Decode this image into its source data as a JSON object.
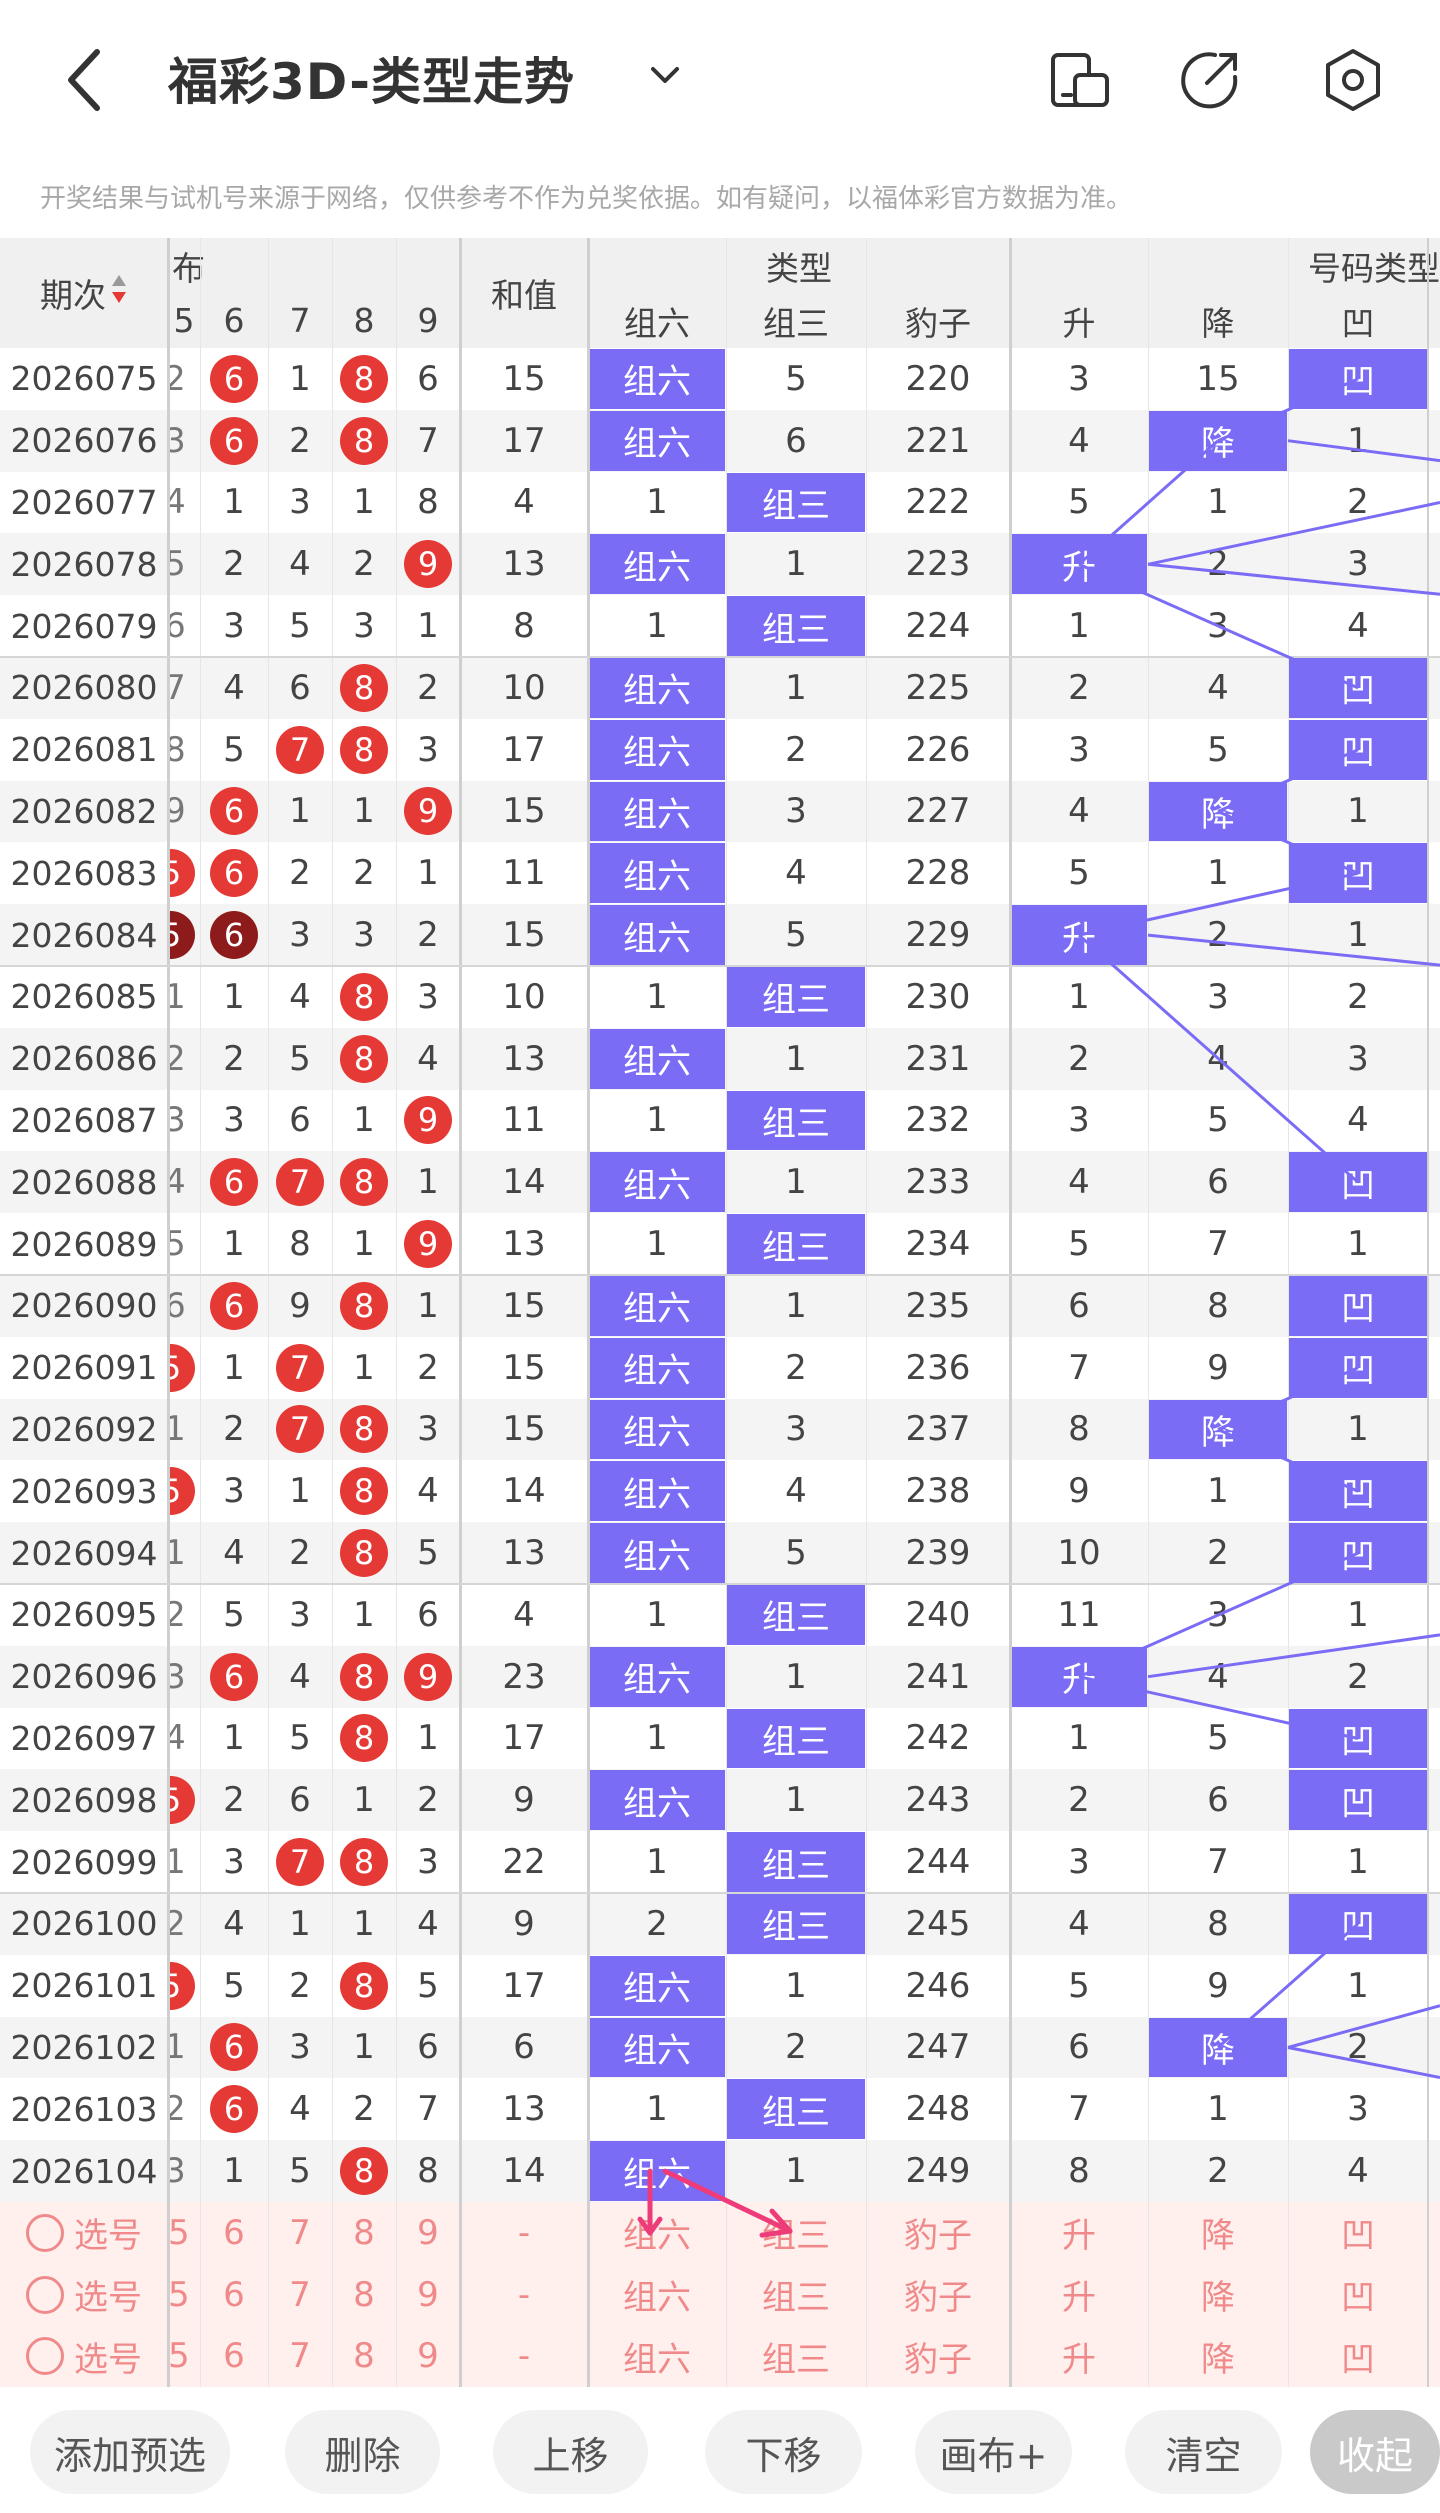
{
  "header": {
    "title": "福彩3D-类型走势",
    "back_icon": "chevron-left-icon",
    "dropdown_icon": "chevron-down-icon",
    "icons": [
      "phone-rotate-icon",
      "share-icon",
      "settings-icon"
    ]
  },
  "notice": "开奖结果与试机号来源于网络，仅供参考不作为兑奖依据。如有疑问，以福体彩官方数据为准。",
  "table": {
    "period_header": "期次",
    "dist_header": "布",
    "digit_headers": [
      "5",
      "6",
      "7",
      "8",
      "9"
    ],
    "sum_header": "和值",
    "type_header": "类型",
    "type_subs": [
      "组六",
      "组三",
      "豹子"
    ],
    "numtype_header": "号码类型",
    "numtype_subs": [
      "升",
      "降",
      "凹"
    ],
    "rows": [
      {
        "p": "2026075",
        "d": [
          "2",
          "6",
          "1",
          "8",
          "6"
        ],
        "s": "15",
        "t": [
          "组六",
          "5",
          "220"
        ],
        "n": [
          "3",
          "15",
          "凹"
        ]
      },
      {
        "p": "2026076",
        "d": [
          "3",
          "6",
          "2",
          "8",
          "7"
        ],
        "s": "17",
        "t": [
          "组六",
          "6",
          "221"
        ],
        "n": [
          "4",
          "降",
          "1"
        ]
      },
      {
        "p": "2026077",
        "d": [
          "4",
          "1",
          "3",
          "1",
          "8"
        ],
        "s": "4",
        "t": [
          "1",
          "组三",
          "222"
        ],
        "n": [
          "5",
          "1",
          "2"
        ]
      },
      {
        "p": "2026078",
        "d": [
          "5",
          "2",
          "4",
          "2",
          "9"
        ],
        "s": "13",
        "t": [
          "组六",
          "1",
          "223"
        ],
        "n": [
          "升",
          "2",
          "3"
        ]
      },
      {
        "p": "2026079",
        "d": [
          "6",
          "3",
          "5",
          "3",
          "1"
        ],
        "s": "8",
        "t": [
          "1",
          "组三",
          "224"
        ],
        "n": [
          "1",
          "3",
          "4"
        ]
      },
      {
        "p": "2026080",
        "d": [
          "7",
          "4",
          "6",
          "8",
          "2"
        ],
        "s": "10",
        "t": [
          "组六",
          "1",
          "225"
        ],
        "n": [
          "2",
          "4",
          "凹"
        ]
      },
      {
        "p": "2026081",
        "d": [
          "8",
          "5",
          "7",
          "8",
          "3"
        ],
        "s": "17",
        "t": [
          "组六",
          "2",
          "226"
        ],
        "n": [
          "3",
          "5",
          "凹"
        ]
      },
      {
        "p": "2026082",
        "d": [
          "9",
          "6",
          "1",
          "1",
          "9"
        ],
        "s": "15",
        "t": [
          "组六",
          "3",
          "227"
        ],
        "n": [
          "4",
          "降",
          "1"
        ]
      },
      {
        "p": "2026083",
        "d": [
          "5",
          "6",
          "2",
          "2",
          "1"
        ],
        "s": "11",
        "t": [
          "组六",
          "4",
          "228"
        ],
        "n": [
          "5",
          "1",
          "凹"
        ]
      },
      {
        "p": "2026084",
        "d": [
          "5",
          "6",
          "3",
          "3",
          "2"
        ],
        "s": "15",
        "t": [
          "组六",
          "5",
          "229"
        ],
        "n": [
          "升",
          "2",
          "1"
        ]
      },
      {
        "p": "2026085",
        "d": [
          "1",
          "1",
          "4",
          "8",
          "3"
        ],
        "s": "10",
        "t": [
          "1",
          "组三",
          "230"
        ],
        "n": [
          "1",
          "3",
          "2"
        ]
      },
      {
        "p": "2026086",
        "d": [
          "2",
          "2",
          "5",
          "8",
          "4"
        ],
        "s": "13",
        "t": [
          "组六",
          "1",
          "231"
        ],
        "n": [
          "2",
          "4",
          "3"
        ]
      },
      {
        "p": "2026087",
        "d": [
          "3",
          "3",
          "6",
          "1",
          "9"
        ],
        "s": "11",
        "t": [
          "1",
          "组三",
          "232"
        ],
        "n": [
          "3",
          "5",
          "4"
        ]
      },
      {
        "p": "2026088",
        "d": [
          "4",
          "6",
          "7",
          "8",
          "1"
        ],
        "s": "14",
        "t": [
          "组六",
          "1",
          "233"
        ],
        "n": [
          "4",
          "6",
          "凹"
        ]
      },
      {
        "p": "2026089",
        "d": [
          "5",
          "1",
          "8",
          "1",
          "9"
        ],
        "s": "13",
        "t": [
          "1",
          "组三",
          "234"
        ],
        "n": [
          "5",
          "7",
          "1"
        ]
      },
      {
        "p": "2026090",
        "d": [
          "6",
          "6",
          "9",
          "8",
          "1"
        ],
        "s": "15",
        "t": [
          "组六",
          "1",
          "235"
        ],
        "n": [
          "6",
          "8",
          "凹"
        ]
      },
      {
        "p": "2026091",
        "d": [
          "5",
          "1",
          "7",
          "1",
          "2"
        ],
        "s": "15",
        "t": [
          "组六",
          "2",
          "236"
        ],
        "n": [
          "7",
          "9",
          "凹"
        ]
      },
      {
        "p": "2026092",
        "d": [
          "1",
          "2",
          "7",
          "8",
          "3"
        ],
        "s": "15",
        "t": [
          "组六",
          "3",
          "237"
        ],
        "n": [
          "8",
          "降",
          "1"
        ]
      },
      {
        "p": "2026093",
        "d": [
          "5",
          "3",
          "1",
          "8",
          "4"
        ],
        "s": "14",
        "t": [
          "组六",
          "4",
          "238"
        ],
        "n": [
          "9",
          "1",
          "凹"
        ]
      },
      {
        "p": "2026094",
        "d": [
          "1",
          "4",
          "2",
          "8",
          "5"
        ],
        "s": "13",
        "t": [
          "组六",
          "5",
          "239"
        ],
        "n": [
          "10",
          "2",
          "凹"
        ]
      },
      {
        "p": "2026095",
        "d": [
          "2",
          "5",
          "3",
          "1",
          "6"
        ],
        "s": "4",
        "t": [
          "1",
          "组三",
          "240"
        ],
        "n": [
          "11",
          "3",
          "1"
        ]
      },
      {
        "p": "2026096",
        "d": [
          "3",
          "6",
          "4",
          "8",
          "9"
        ],
        "s": "23",
        "t": [
          "组六",
          "1",
          "241"
        ],
        "n": [
          "升",
          "4",
          "2"
        ]
      },
      {
        "p": "2026097",
        "d": [
          "4",
          "1",
          "5",
          "8",
          "1"
        ],
        "s": "17",
        "t": [
          "1",
          "组三",
          "242"
        ],
        "n": [
          "1",
          "5",
          "凹"
        ]
      },
      {
        "p": "2026098",
        "d": [
          "5",
          "2",
          "6",
          "1",
          "2"
        ],
        "s": "9",
        "t": [
          "组六",
          "1",
          "243"
        ],
        "n": [
          "2",
          "6",
          "凹"
        ]
      },
      {
        "p": "2026099",
        "d": [
          "1",
          "3",
          "7",
          "8",
          "3"
        ],
        "s": "22",
        "t": [
          "1",
          "组三",
          "244"
        ],
        "n": [
          "3",
          "7",
          "1"
        ]
      },
      {
        "p": "2026100",
        "d": [
          "2",
          "4",
          "1",
          "1",
          "4"
        ],
        "s": "9",
        "t": [
          "2",
          "组三",
          "245"
        ],
        "n": [
          "4",
          "8",
          "凹"
        ]
      },
      {
        "p": "2026101",
        "d": [
          "5",
          "5",
          "2",
          "8",
          "5"
        ],
        "s": "17",
        "t": [
          "组六",
          "1",
          "246"
        ],
        "n": [
          "5",
          "9",
          "1"
        ]
      },
      {
        "p": "2026102",
        "d": [
          "1",
          "6",
          "3",
          "1",
          "6"
        ],
        "s": "6",
        "t": [
          "组六",
          "2",
          "247"
        ],
        "n": [
          "6",
          "降",
          "2"
        ]
      },
      {
        "p": "2026103",
        "d": [
          "2",
          "6",
          "4",
          "2",
          "7"
        ],
        "s": "13",
        "t": [
          "1",
          "组三",
          "248"
        ],
        "n": [
          "7",
          "1",
          "3"
        ]
      },
      {
        "p": "2026104",
        "d": [
          "3",
          "1",
          "5",
          "8",
          "8"
        ],
        "s": "14",
        "t": [
          "组六",
          "1",
          "249"
        ],
        "n": [
          "8",
          "2",
          "4"
        ]
      }
    ],
    "select_label": "选号",
    "select_rows": 3,
    "select_digits": [
      "5",
      "6",
      "7",
      "8",
      "9"
    ],
    "select_sum": "-",
    "select_types": [
      "组六",
      "组三",
      "豹子"
    ],
    "select_numtypes": [
      "升",
      "降",
      "凹"
    ]
  },
  "bottom_bar": [
    "添加预选",
    "删除",
    "上移",
    "下移",
    "画布+",
    "清空",
    "收起"
  ],
  "colors": {
    "highlight": "#7b6cf6",
    "ball": "#e53935",
    "ball_dark": "#8e1b1b",
    "pink_bg": "#fff0ee",
    "pink_text": "#f08a8a",
    "arrow": "#ee3b7a"
  }
}
